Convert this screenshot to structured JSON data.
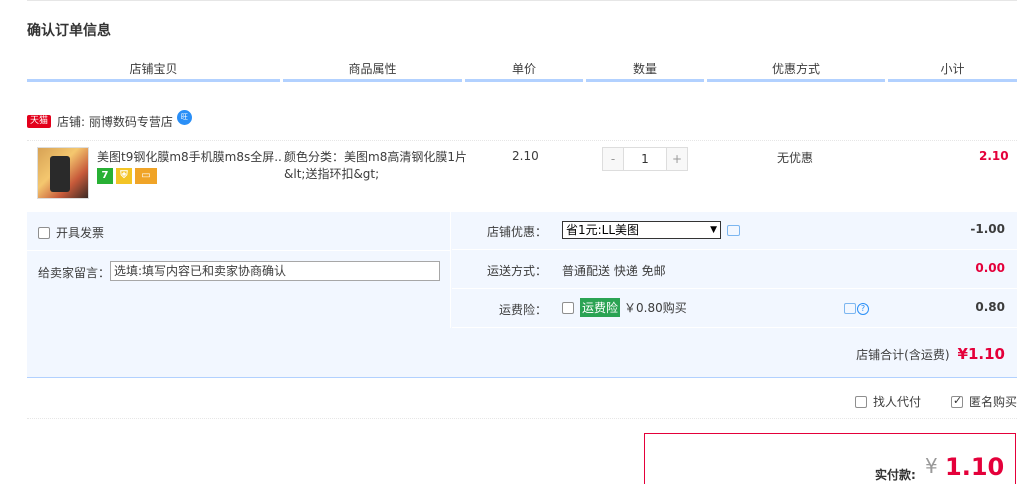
{
  "title": "确认订单信息",
  "columns": [
    "店铺宝贝",
    "商品属性",
    "单价",
    "数量",
    "优惠方式",
    "小计"
  ],
  "shop": {
    "tmall_badge": "天猫",
    "label": "店铺: 丽博数码专营店"
  },
  "item": {
    "title": "美图t9钢化膜m8手机膜m8s全屏...",
    "attr": "颜色分类：美图m8高清钢化膜1片 &lt;送指环扣&gt;",
    "price": "2.10",
    "quantity": "1",
    "minus": "-",
    "plus": "+",
    "promo": "无优惠",
    "subtotal": "2.10",
    "badge_7": "7"
  },
  "options": {
    "invoice_label": "开具发票",
    "message_label": "给卖家留言：",
    "message_placeholder": "选填:填写内容已和卖家协商确认",
    "shop_discount_label": "店铺优惠：",
    "shop_discount_selected": "省1元:LL美图",
    "shop_discount_value": "-1.00",
    "shipping_label": "运送方式：",
    "shipping_text": "普通配送 快递 免邮",
    "shipping_value": "0.00",
    "insurance_label": "运费险：",
    "insurance_tag": "运费险",
    "insurance_price": "￥0.80购买",
    "insurance_value": "0.80",
    "shop_total_label": "店铺合计(含运费)",
    "shop_total_value": "¥1.10"
  },
  "footer": {
    "proxy_pay": "找人代付",
    "anonymous": "匿名购买",
    "anonymous_checked": true,
    "pay_label": "实付款:",
    "pay_currency": "¥",
    "pay_amount": "1.10"
  },
  "colors": {
    "accent_red": "#e4003a",
    "header_underline": "#b2d1ff",
    "panel_bg": "#f2f7ff",
    "insurance_green": "#2aa353"
  }
}
